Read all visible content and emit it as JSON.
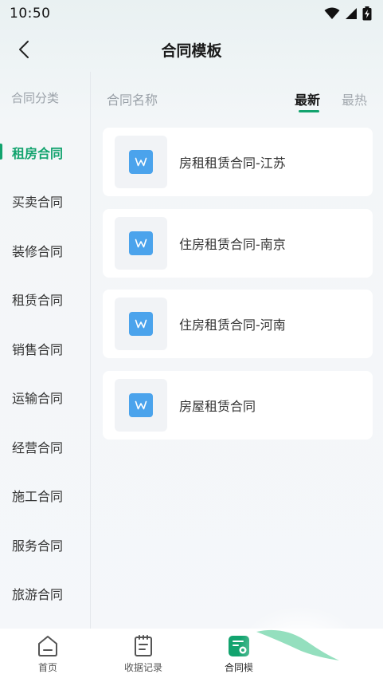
{
  "status_bar": {
    "time": "10:50"
  },
  "header": {
    "title": "合同模板"
  },
  "sidebar": {
    "heading": "合同分类",
    "items": [
      {
        "label": "租房合同",
        "active": true
      },
      {
        "label": "买卖合同"
      },
      {
        "label": "装修合同"
      },
      {
        "label": "租赁合同"
      },
      {
        "label": "销售合同"
      },
      {
        "label": "运输合同"
      },
      {
        "label": "经营合同"
      },
      {
        "label": "施工合同"
      },
      {
        "label": "服务合同"
      },
      {
        "label": "旅游合同"
      }
    ]
  },
  "content": {
    "column_label": "合同名称",
    "sort_tabs": {
      "latest": "最新",
      "hot": "最热"
    },
    "cards": [
      {
        "title": "房租租赁合同-江苏",
        "icon": "word-document-icon"
      },
      {
        "title": "住房租赁合同-南京",
        "icon": "word-document-icon"
      },
      {
        "title": "住房租赁合同-河南",
        "icon": "word-document-icon"
      },
      {
        "title": "房屋租赁合同",
        "icon": "word-document-icon"
      }
    ]
  },
  "bottom_nav": {
    "items": [
      {
        "label": "首页",
        "icon": "home-icon"
      },
      {
        "label": "收据记录",
        "icon": "receipt-icon"
      },
      {
        "label": "合同模",
        "icon": "contract-template-icon",
        "active": true
      }
    ]
  },
  "colors": {
    "accent": "#12a36e",
    "doc_blue": "#4ba3ec"
  }
}
